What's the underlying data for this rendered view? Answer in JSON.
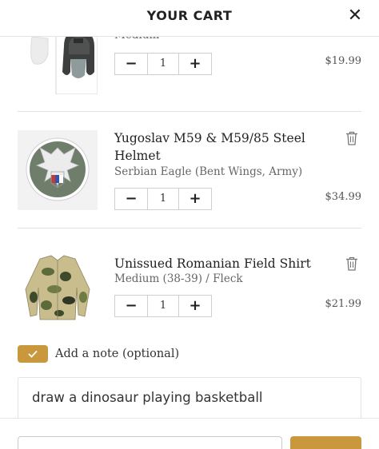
{
  "header": {
    "title": "YOUR CART",
    "close_label": "✕"
  },
  "items": [
    {
      "variant": "Medium",
      "quantity": "1",
      "price": "$19.99"
    },
    {
      "title": "Yugoslav M59 & M59/85 Steel Helmet",
      "variant": "Serbian Eagle (Bent Wings, Army)",
      "quantity": "1",
      "price": "$34.99"
    },
    {
      "title": "Unissued Romanian Field Shirt",
      "variant": "Medium (38-39) / Fleck",
      "quantity": "1",
      "price": "$21.99"
    }
  ],
  "qty_controls": {
    "minus": "−",
    "plus": "+"
  },
  "note": {
    "label": "Add a note (optional)",
    "checked": true,
    "value": "draw a dinosaur playing basketball"
  },
  "colors": {
    "accent": "#c9973c",
    "divider": "#e2e2e2"
  }
}
